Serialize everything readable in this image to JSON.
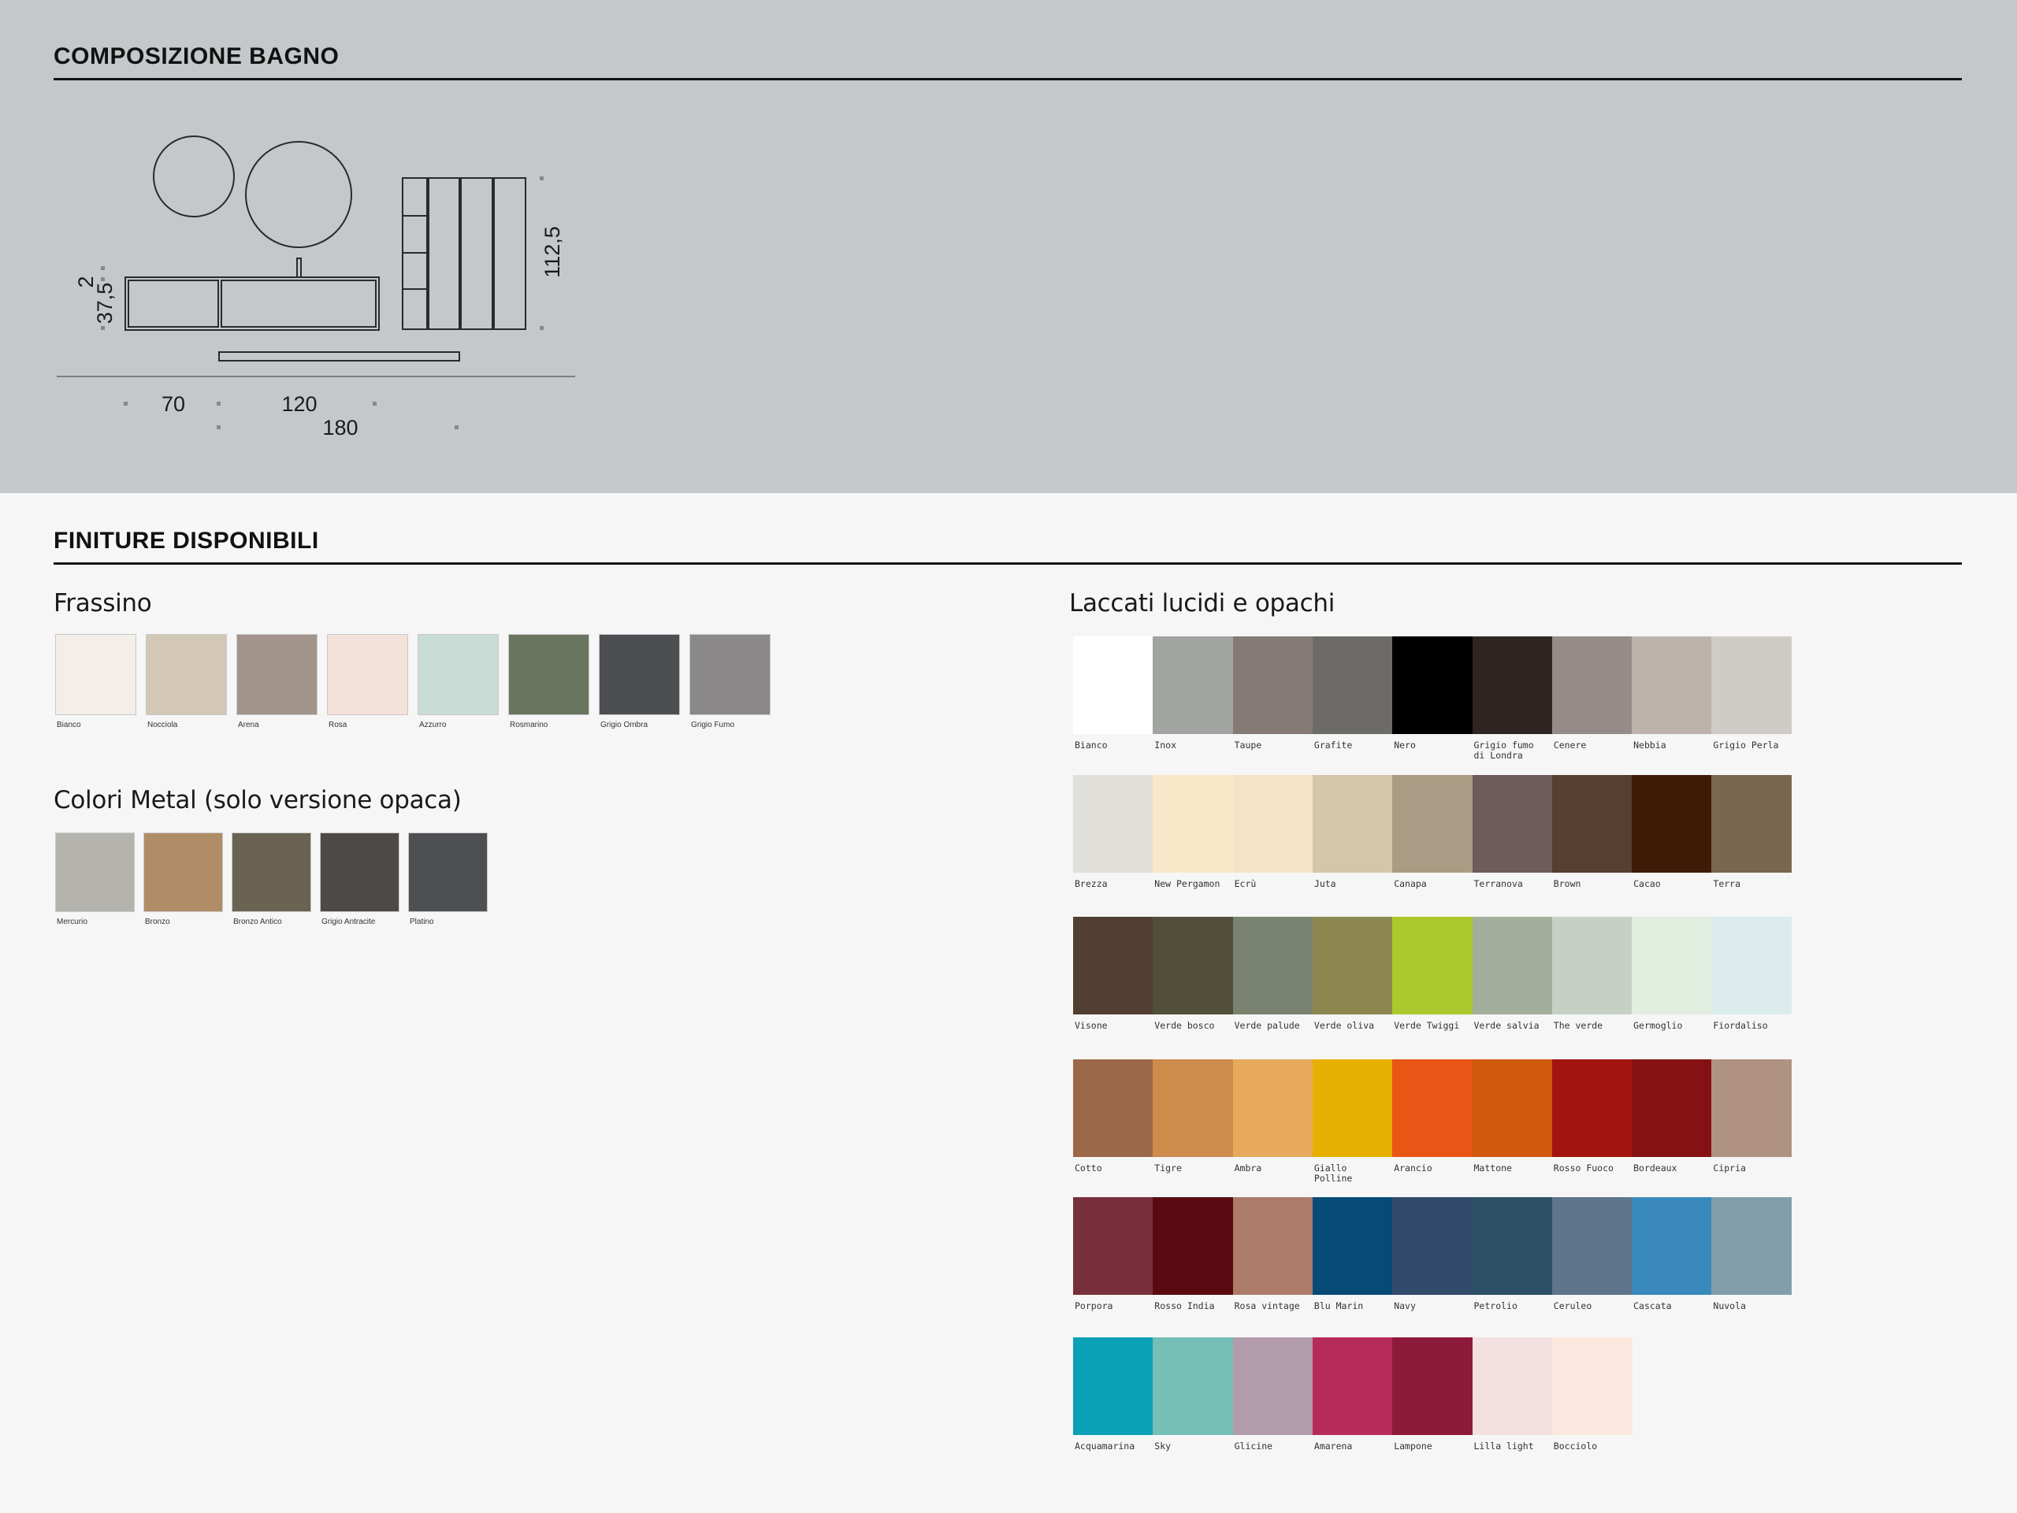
{
  "composition": {
    "title": "COMPOSIZIONE BAGNO",
    "dimensions": {
      "d_top": "2",
      "d_height": "37,5",
      "d_tall": "112,5",
      "d_70": "70",
      "d_120": "120",
      "d_180": "180"
    }
  },
  "finishes": {
    "title": "FINITURE DISPONIBILI",
    "frassino": {
      "title": "Frassino",
      "items": [
        {
          "label": "Bianco",
          "color": "#f3efe8"
        },
        {
          "label": "Nocciola",
          "color": "#d2c8b5"
        },
        {
          "label": "Arena",
          "color": "#a2948b"
        },
        {
          "label": "Rosa",
          "color": "#f4e1d9"
        },
        {
          "label": "Azzurro",
          "color": "#c9dcd6"
        },
        {
          "label": "Rosmarino",
          "color": "#6a7560"
        },
        {
          "label": "Grigio Ombra",
          "color": "#4d4e52"
        },
        {
          "label": "Grigio Fumo",
          "color": "#8b888a"
        }
      ]
    },
    "metal": {
      "title": "Colori Metal (solo versione opaca)",
      "items": [
        {
          "label": "Mercurio",
          "color": "#b4b3ae"
        },
        {
          "label": "Bronzo",
          "color": "#b08c67"
        },
        {
          "label": "Bronzo Antico",
          "color": "#6a6352"
        },
        {
          "label": "Grigio Antracite",
          "color": "#4c4946"
        },
        {
          "label": "Platino",
          "color": "#4d4f52"
        }
      ]
    },
    "lacquers": {
      "title": "Laccati lucidi e opachi",
      "rows": [
        [
          {
            "label": "Bianco",
            "color": "#ffffff"
          },
          {
            "label": "Inox",
            "color": "#a2a4a1"
          },
          {
            "label": "Taupe",
            "color": "#857a76"
          },
          {
            "label": "Grafite",
            "color": "#6c6b67"
          },
          {
            "label": "Nero",
            "color": "#000000"
          },
          {
            "label": "Grigio fumo di Londra",
            "color": "#2e2522"
          },
          {
            "label": "Cenere",
            "color": "#958b89"
          },
          {
            "label": "Nebbia",
            "color": "#bdb3ac"
          },
          {
            "label": "Grigio Perla",
            "color": "#cfcbc7"
          }
        ],
        [
          {
            "label": "Brezza",
            "color": "#e0dfda"
          },
          {
            "label": "New Pergamon",
            "color": "#f9e7c9"
          },
          {
            "label": "Ecrù",
            "color": "#f4e3c6"
          },
          {
            "label": "Juta",
            "color": "#d5c6a9"
          },
          {
            "label": "Canapa",
            "color": "#ab9b84"
          },
          {
            "label": "Terranova",
            "color": "#6f5b5a"
          },
          {
            "label": "Brown",
            "color": "#573e31"
          },
          {
            "label": "Cacao",
            "color": "#3e1b07"
          },
          {
            "label": "Terra",
            "color": "#7b674f"
          }
        ],
        [
          {
            "label": "Visone",
            "color": "#523e30"
          },
          {
            "label": "Verde bosco",
            "color": "#514e3a"
          },
          {
            "label": "Verde palude",
            "color": "#7a8370"
          },
          {
            "label": "Verde oliva",
            "color": "#8b874f"
          },
          {
            "label": "Verde Twiggi",
            "color": "#abc92d"
          },
          {
            "label": "Verde salvia",
            "color": "#a3ad9b"
          },
          {
            "label": "The verde",
            "color": "#c7d0c5"
          },
          {
            "label": "Germoglio",
            "color": "#e1eee0"
          },
          {
            "label": "Fiordaliso",
            "color": "#dcecec"
          }
        ],
        [
          {
            "label": "Cotto",
            "color": "#9b6848"
          },
          {
            "label": "Tigre",
            "color": "#cd8b4c"
          },
          {
            "label": "Ambra",
            "color": "#e7aa5d"
          },
          {
            "label": "Giallo Polline",
            "color": "#e5b002"
          },
          {
            "label": "Arancio",
            "color": "#e95515"
          },
          {
            "label": "Mattone",
            "color": "#d0590e"
          },
          {
            "label": "Rosso Fuoco",
            "color": "#a3130f"
          },
          {
            "label": "Bordeaux",
            "color": "#851114"
          },
          {
            "label": "Cipria",
            "color": "#b09283"
          }
        ],
        [
          {
            "label": "Porpora",
            "color": "#77303b"
          },
          {
            "label": "Rosso India",
            "color": "#5a0b12"
          },
          {
            "label": "Rosa vintage",
            "color": "#ad7b6a"
          },
          {
            "label": "Blu Marin",
            "color": "#054b76"
          },
          {
            "label": "Navy",
            "color": "#324b6c"
          },
          {
            "label": "Petrolio",
            "color": "#2e5066"
          },
          {
            "label": "Ceruleo",
            "color": "#5e758c"
          },
          {
            "label": "Cascata",
            "color": "#3a89bc"
          },
          {
            "label": "Nuvola",
            "color": "#829eab"
          }
        ],
        [
          {
            "label": "Acquamarina",
            "color": "#0aa0b5"
          },
          {
            "label": "Sky",
            "color": "#76bfb7"
          },
          {
            "label": "Glicine",
            "color": "#b29bab"
          },
          {
            "label": "Amarena",
            "color": "#b52c5a"
          },
          {
            "label": "Lampone",
            "color": "#8e1a3b"
          },
          {
            "label": "Lilla light",
            "color": "#f2e1e0"
          },
          {
            "label": "Bocciolo",
            "color": "#fde8e0"
          }
        ]
      ]
    }
  }
}
